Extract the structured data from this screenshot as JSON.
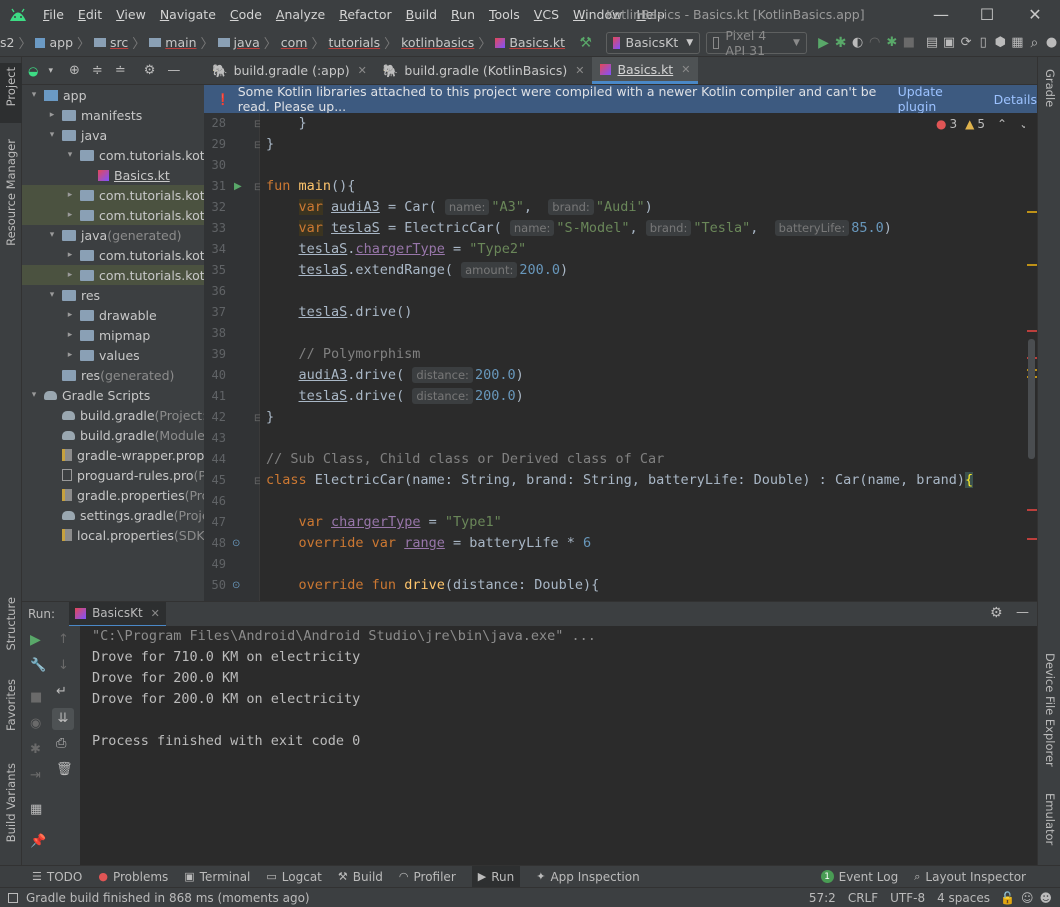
{
  "menubar": {
    "items": [
      "File",
      "Edit",
      "View",
      "Navigate",
      "Code",
      "Analyze",
      "Refactor",
      "Build",
      "Run",
      "Tools",
      "VCS",
      "Window",
      "Help"
    ],
    "title": "KotlinBasics - Basics.kt [KotlinBasics.app]"
  },
  "navbar": {
    "crumbs": [
      "s2",
      "app",
      "src",
      "main",
      "java",
      "com",
      "tutorials",
      "kotlinbasics",
      "Basics.kt"
    ],
    "run_config": "BasicsKt",
    "device": "Pixel 4 API 31"
  },
  "leftstrip": {
    "project": "Project",
    "resource_manager": "Resource Manager",
    "structure": "Structure",
    "favorites": "Favorites",
    "build_variants": "Build Variants"
  },
  "rightstrip": {
    "gradle": "Gradle",
    "device_file_explorer": "Device File Explorer",
    "emulator": "Emulator"
  },
  "tree": [
    {
      "label": "app",
      "indent": 0,
      "arrow": "▾",
      "icon": "module"
    },
    {
      "label": "manifests",
      "indent": 1,
      "arrow": "▸",
      "icon": "folder"
    },
    {
      "label": "java",
      "indent": 1,
      "arrow": "▾",
      "icon": "folder"
    },
    {
      "label": "com.tutorials.kotlin",
      "indent": 2,
      "arrow": "▾",
      "icon": "package"
    },
    {
      "label": "Basics.kt",
      "indent": 3,
      "arrow": "",
      "icon": "kotlin"
    },
    {
      "label": "com.tutorials.kotlin",
      "indent": 2,
      "arrow": "▸",
      "icon": "package",
      "hl": true
    },
    {
      "label": "com.tutorials.kotlin",
      "indent": 2,
      "arrow": "▸",
      "icon": "package",
      "hl": true
    },
    {
      "label": "java",
      "suffix": " (generated)",
      "indent": 1,
      "arrow": "▾",
      "icon": "folder"
    },
    {
      "label": "com.tutorials.kotlin",
      "indent": 2,
      "arrow": "▸",
      "icon": "package"
    },
    {
      "label": "com.tutorials.kotlin",
      "indent": 2,
      "arrow": "▸",
      "icon": "package",
      "hl": true
    },
    {
      "label": "res",
      "indent": 1,
      "arrow": "▾",
      "icon": "folder"
    },
    {
      "label": "drawable",
      "indent": 2,
      "arrow": "▸",
      "icon": "folder"
    },
    {
      "label": "mipmap",
      "indent": 2,
      "arrow": "▸",
      "icon": "folder"
    },
    {
      "label": "values",
      "indent": 2,
      "arrow": "▸",
      "icon": "folder"
    },
    {
      "label": "res",
      "suffix": " (generated)",
      "indent": 1,
      "arrow": "",
      "icon": "folder"
    },
    {
      "label": "Gradle Scripts",
      "indent": 0,
      "arrow": "▾",
      "icon": "gradle"
    },
    {
      "label": "build.gradle",
      "suffix": " (Project: K",
      "indent": 1,
      "arrow": "",
      "icon": "gradle"
    },
    {
      "label": "build.gradle",
      "suffix": " (Module:",
      "indent": 1,
      "arrow": "",
      "icon": "gradle"
    },
    {
      "label": "gradle-wrapper.proper",
      "indent": 1,
      "arrow": "",
      "icon": "props"
    },
    {
      "label": "proguard-rules.pro",
      "suffix": " (Pr",
      "indent": 1,
      "arrow": "",
      "icon": "file"
    },
    {
      "label": "gradle.properties",
      "suffix": " (Proj",
      "indent": 1,
      "arrow": "",
      "icon": "props"
    },
    {
      "label": "settings.gradle",
      "suffix": " (Project",
      "indent": 1,
      "arrow": "",
      "icon": "gradle"
    },
    {
      "label": "local.properties",
      "suffix": " (SDK L",
      "indent": 1,
      "arrow": "",
      "icon": "props"
    }
  ],
  "tabs": [
    {
      "label": "build.gradle (:app)",
      "active": false
    },
    {
      "label": "build.gradle (KotlinBasics)",
      "active": false
    },
    {
      "label": "Basics.kt",
      "active": true
    }
  ],
  "banner": {
    "text": "Some Kotlin libraries attached to this project were compiled with a newer Kotlin compiler and can't be read. Please up...",
    "update": "Update plugin",
    "details": "Details"
  },
  "inspections": {
    "errors": "3",
    "warnings": "5"
  },
  "line_numbers": [
    "28",
    "29",
    "30",
    "31",
    "32",
    "33",
    "34",
    "35",
    "36",
    "37",
    "38",
    "39",
    "40",
    "41",
    "42",
    "43",
    "44",
    "45",
    "46",
    "47",
    "48",
    "49",
    "50"
  ],
  "code_lines": [
    "    }",
    "}",
    "",
    "fun main(){",
    "    var audiA3 = Car( name: \"A3\",  brand: \"Audi\")",
    "    var teslaS = ElectricCar( name: \"S-Model\", brand: \"Tesla\",  batteryLife: 85.0)",
    "    teslaS.chargerType = \"Type2\"",
    "    teslaS.extendRange( amount: 200.0)",
    "",
    "    teslaS.drive()",
    "",
    "    // Polymorphism",
    "    audiA3.drive( distance: 200.0)",
    "    teslaS.drive( distance: 200.0)",
    "}",
    "",
    "// Sub Class, Child class or Derived class of Car",
    "class ElectricCar(name: String, brand: String, batteryLife: Double) : Car(name, brand){",
    "",
    "    var chargerType = \"Type1\"",
    "    override var range = batteryLife * 6",
    "",
    "    override fun drive(distance: Double){"
  ],
  "run": {
    "label": "Run:",
    "tab": "BasicsKt",
    "output": [
      "\"C:\\Program Files\\Android\\Android Studio\\jre\\bin\\java.exe\" ...",
      "Drove for 710.0 KM on electricity",
      "Drove for 200.0 KM",
      "Drove for 200.0 KM on electricity",
      "",
      "Process finished with exit code 0"
    ]
  },
  "bottom_tabs": [
    "TODO",
    "Problems",
    "Terminal",
    "Logcat",
    "Build",
    "Profiler",
    "Run",
    "App Inspection"
  ],
  "bottom_right": {
    "event_log": "Event Log",
    "event_count": "1",
    "layout_inspector": "Layout Inspector"
  },
  "status": {
    "message": "Gradle build finished in 868 ms (moments ago)",
    "position": "57:2",
    "line_sep": "CRLF",
    "encoding": "UTF-8",
    "indent": "4 spaces"
  },
  "colors": {
    "accent": "#4a88c7",
    "banner": "#3d5a80",
    "keyword": "#cc7832",
    "string": "#6a8759",
    "number": "#6897bb",
    "function": "#ffc66d",
    "property": "#9876aa"
  }
}
